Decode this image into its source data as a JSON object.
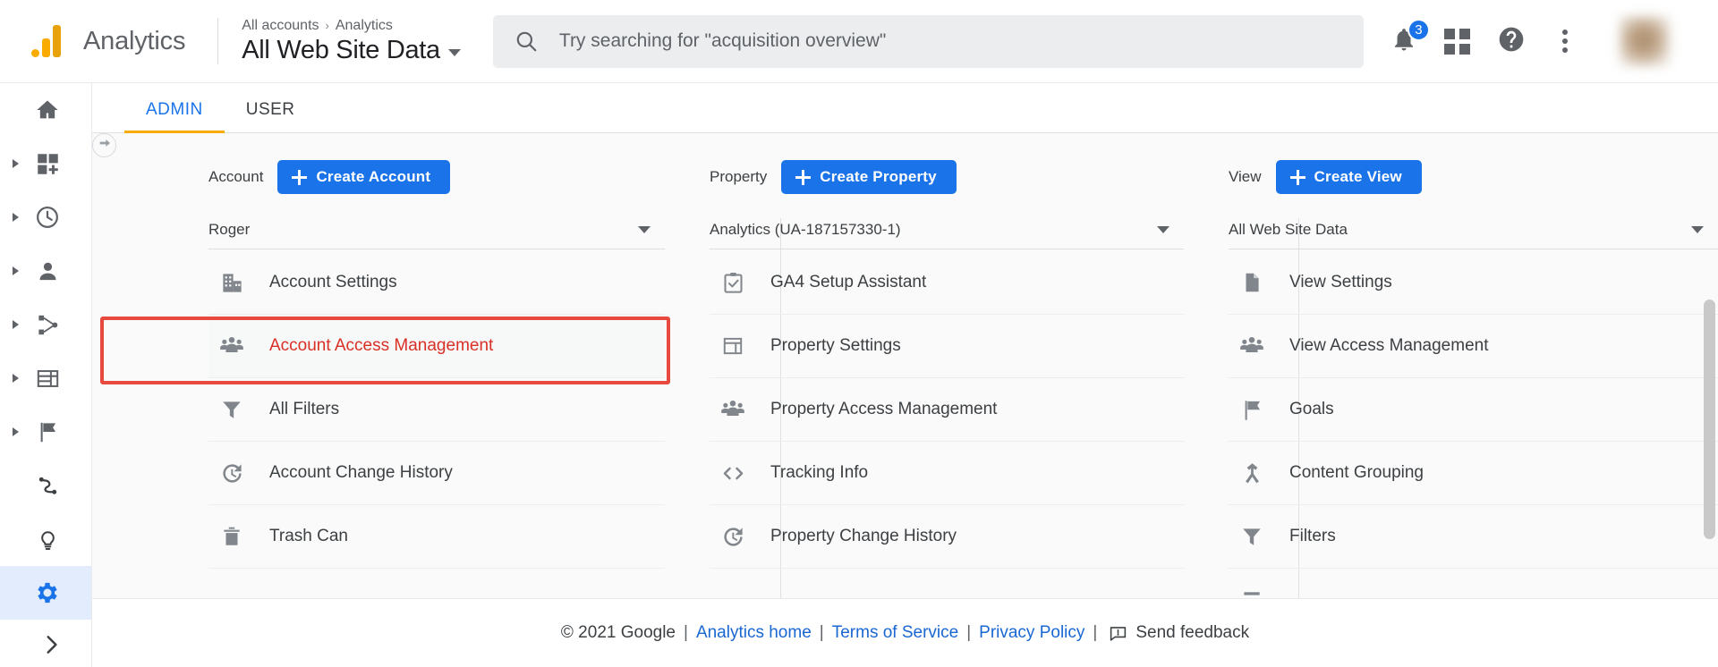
{
  "header": {
    "brand": "Analytics",
    "logo_icon": "analytics-bars-logo",
    "breadcrumb_parent": "All accounts",
    "breadcrumb_sep": "›",
    "breadcrumb_child": "Analytics",
    "view_title": "All Web Site Data",
    "search": {
      "icon": "search-icon",
      "placeholder": "Try searching for \"acquisition overview\""
    },
    "icons": {
      "notifications": "bell-icon",
      "notification_count": "3",
      "apps": "apps-grid-icon",
      "help": "help-circle-icon",
      "more": "more-vertical-icon",
      "avatar": "user-avatar"
    }
  },
  "sidebar": {
    "items": [
      {
        "name": "home",
        "icon": "home-icon",
        "expandable": false,
        "active": false
      },
      {
        "name": "customization",
        "icon": "customization-grid-icon",
        "expandable": true,
        "active": false
      },
      {
        "name": "realtime",
        "icon": "clock-icon",
        "expandable": true,
        "active": false
      },
      {
        "name": "audience",
        "icon": "person-icon",
        "expandable": true,
        "active": false
      },
      {
        "name": "acquisition",
        "icon": "share-nodes-icon",
        "expandable": true,
        "active": false
      },
      {
        "name": "behavior",
        "icon": "table-icon",
        "expandable": true,
        "active": false
      },
      {
        "name": "conversions",
        "icon": "flag-icon",
        "expandable": true,
        "active": false
      },
      {
        "name": "discover",
        "icon": "path-icon",
        "expandable": false,
        "active": false
      },
      {
        "name": "insights",
        "icon": "lightbulb-icon",
        "expandable": false,
        "active": false
      },
      {
        "name": "admin",
        "icon": "gear-icon",
        "expandable": false,
        "active": true
      }
    ],
    "expand_icon": "chevron-right-icon"
  },
  "tabs": [
    {
      "label": "ADMIN",
      "active": true
    },
    {
      "label": "USER",
      "active": false
    }
  ],
  "columns": {
    "account": {
      "label": "Account",
      "create_button": "Create Account",
      "selected": "Roger",
      "menu": [
        {
          "label": "Account Settings",
          "icon": "building-icon",
          "highlighted": false
        },
        {
          "label": "Account Access Management",
          "icon": "people-icon",
          "highlighted": true
        },
        {
          "label": "All Filters",
          "icon": "funnel-icon",
          "highlighted": false
        },
        {
          "label": "Account Change History",
          "icon": "history-icon",
          "highlighted": false
        },
        {
          "label": "Trash Can",
          "icon": "trash-icon",
          "highlighted": false
        }
      ]
    },
    "property": {
      "label": "Property",
      "create_button": "Create Property",
      "selected": "Analytics (UA-187157330-1)",
      "menu": [
        {
          "label": "GA4 Setup Assistant",
          "icon": "clipboard-check-icon",
          "highlighted": false
        },
        {
          "label": "Property Settings",
          "icon": "layout-icon",
          "highlighted": false
        },
        {
          "label": "Property Access Management",
          "icon": "people-icon",
          "highlighted": false
        },
        {
          "label": "Tracking Info",
          "icon": "code-brackets-icon",
          "highlighted": false
        },
        {
          "label": "Property Change History",
          "icon": "history-icon",
          "highlighted": false
        }
      ]
    },
    "view": {
      "label": "View",
      "create_button": "Create View",
      "selected": "All Web Site Data",
      "menu": [
        {
          "label": "View Settings",
          "icon": "document-icon",
          "highlighted": false
        },
        {
          "label": "View Access Management",
          "icon": "people-icon",
          "highlighted": false
        },
        {
          "label": "Goals",
          "icon": "flag-icon",
          "highlighted": false
        },
        {
          "label": "Content Grouping",
          "icon": "content-grouping-icon",
          "highlighted": false
        },
        {
          "label": "Filters",
          "icon": "funnel-icon",
          "highlighted": false
        }
      ]
    }
  },
  "footer": {
    "copyright": "© 2021 Google",
    "link_home": "Analytics home",
    "link_terms": "Terms of Service",
    "link_privacy": "Privacy Policy",
    "feedback": "Send feedback",
    "feedback_icon": "feedback-icon",
    "pipe": "|"
  },
  "colors": {
    "accent_blue": "#1a73e8",
    "brand_orange": "#f9ab00",
    "highlight_red": "#e8493e",
    "highlight_text_red": "#d93025",
    "link_blue": "#1967d2"
  }
}
